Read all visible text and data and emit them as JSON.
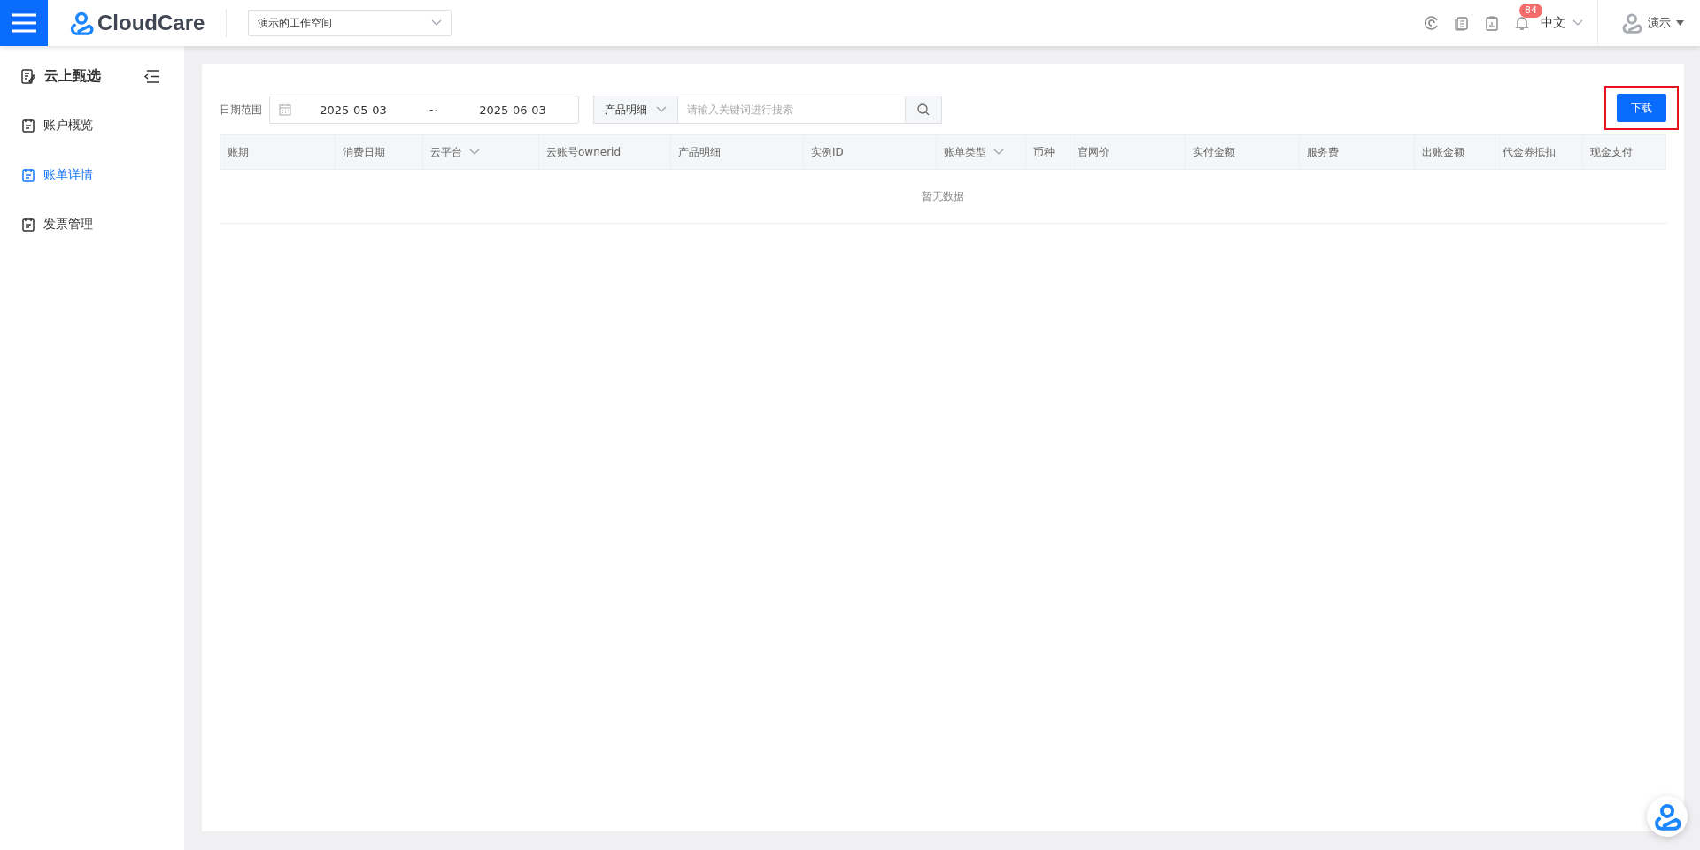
{
  "header": {
    "brand": "CloudCare",
    "workspace": "演示的工作空间",
    "notification_count": "84",
    "language": "中文",
    "user": "演示"
  },
  "sidebar": {
    "title": "云上甄选",
    "items": [
      {
        "label": "账户概览",
        "selected": false
      },
      {
        "label": "账单详情",
        "selected": true
      },
      {
        "label": "发票管理",
        "selected": false
      }
    ]
  },
  "filters": {
    "date_label": "日期范围",
    "start_date": "2025-05-03",
    "separator": "~",
    "end_date": "2025-06-03",
    "search_type": "产品明细",
    "search": {
      "placeholder": "请输入关键词进行搜索"
    }
  },
  "download_button": "下载",
  "table": {
    "columns": [
      {
        "label": "账期",
        "filter": false
      },
      {
        "label": "消费日期",
        "filter": false
      },
      {
        "label": "云平台",
        "filter": true
      },
      {
        "label": "云账号ownerid",
        "filter": false
      },
      {
        "label": "产品明细",
        "filter": false
      },
      {
        "label": "实例ID",
        "filter": false
      },
      {
        "label": "账单类型",
        "filter": true
      },
      {
        "label": "币种",
        "filter": false
      },
      {
        "label": "官网价",
        "filter": false
      },
      {
        "label": "实付金额",
        "filter": false
      },
      {
        "label": "服务费",
        "filter": false
      },
      {
        "label": "出账金额",
        "filter": false
      },
      {
        "label": "代金券抵扣",
        "filter": false
      },
      {
        "label": "现金支付",
        "filter": false
      }
    ],
    "empty_text": "暂无数据"
  }
}
